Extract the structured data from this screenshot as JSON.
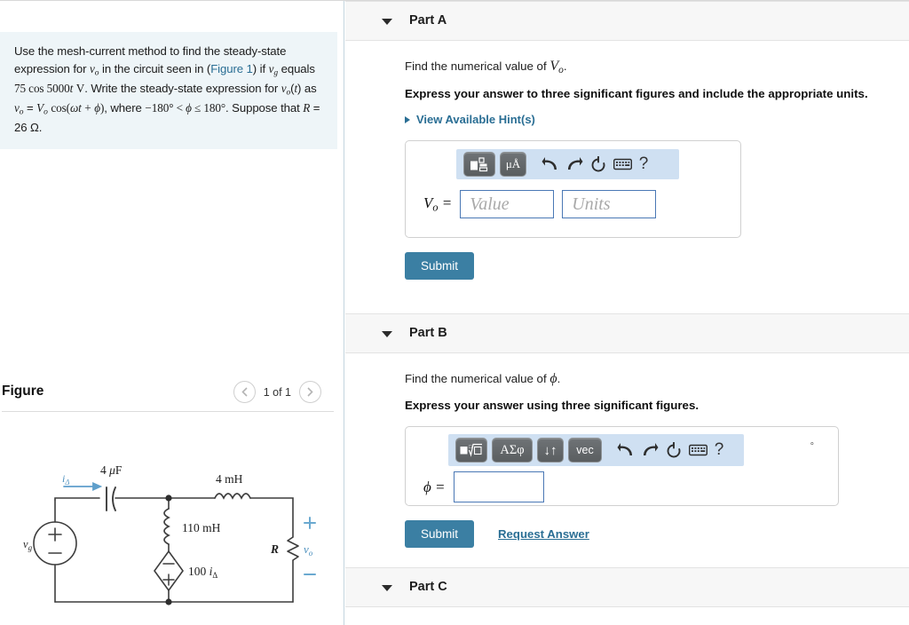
{
  "problem": {
    "paragraph_parts": [
      "Use the mesh-current method to find the steady-state expression for ",
      "v",
      "o",
      " in the circuit seen in (",
      "Figure 1",
      ") if ",
      "v",
      "g",
      " equals ",
      "75 cos 5000t",
      " V. Write the steady-state expression for ",
      "v",
      "o",
      "(",
      "t",
      ") as ",
      "v",
      "o",
      " = ",
      "V",
      "o",
      " cos(",
      "ωt",
      " + ",
      "φ",
      "), where ",
      "−180° < φ ≤ 180°",
      ". Suppose that ",
      "R",
      " = 26 Ω."
    ],
    "figure_link": "Figure 1",
    "resistance": "R = 26 Ω",
    "source": "75 cos 5000t V",
    "phase_range": "−180° < ϕ ≤ 180°"
  },
  "figure": {
    "title": "Figure",
    "counter": "1 of 1",
    "prev_icon": "chevron-left-icon",
    "next_icon": "chevron-right-icon",
    "circuit": {
      "source_label": "vg",
      "current_label": "iΔ",
      "capacitor": "4 μF",
      "series_inductor": "4 mH",
      "shunt_inductor": "110 mH",
      "dependent_source": "100 iΔ",
      "resistor_label": "R",
      "output_label": "vo",
      "plus": "+",
      "minus": "−"
    }
  },
  "parts": [
    {
      "id": "part-a",
      "label": "Part A",
      "caret_icon": "caret-down-icon",
      "question": "Find the numerical value of Vo.",
      "question_prefix": "Find the numerical value of ",
      "question_var": "V",
      "question_sub": "o",
      "instruction": "Express your answer to three significant figures and include the appropriate units.",
      "hint_label": "View Available Hint(s)",
      "hint_icon": "caret-right-icon",
      "answer_label": "Vo =",
      "toolbar": [
        {
          "name": "math-template-button",
          "glyph": "template"
        },
        {
          "name": "units-button",
          "glyph": "μÅ"
        },
        {
          "name": "undo-button",
          "glyph": "undo"
        },
        {
          "name": "redo-button",
          "glyph": "redo"
        },
        {
          "name": "reset-button",
          "glyph": "reset"
        },
        {
          "name": "keyboard-button",
          "glyph": "keyboard"
        },
        {
          "name": "help-button",
          "glyph": "?"
        }
      ],
      "value_placeholder": "Value",
      "units_placeholder": "Units",
      "submit_label": "Submit"
    },
    {
      "id": "part-b",
      "label": "Part B",
      "caret_icon": "caret-down-icon",
      "question": "Find the numerical value of ϕ.",
      "question_prefix": "Find the numerical value of ",
      "question_var": "ϕ",
      "instruction": "Express your answer using three significant figures.",
      "answer_label": "ϕ =",
      "degree_symbol": "°",
      "toolbar": [
        {
          "name": "math-template-button",
          "glyph": "radical"
        },
        {
          "name": "greek-button",
          "glyph": "ΑΣφ"
        },
        {
          "name": "arrows-button",
          "glyph": "↓↑"
        },
        {
          "name": "vector-button",
          "glyph": "vec"
        },
        {
          "name": "undo-button",
          "glyph": "undo"
        },
        {
          "name": "redo-button",
          "glyph": "redo"
        },
        {
          "name": "reset-button",
          "glyph": "reset"
        },
        {
          "name": "keyboard-button",
          "glyph": "keyboard"
        },
        {
          "name": "help-button",
          "glyph": "?"
        }
      ],
      "input_value": "",
      "submit_label": "Submit",
      "request_answer_label": "Request Answer"
    },
    {
      "id": "part-c",
      "label": "Part C",
      "caret_icon": "caret-down-icon"
    }
  ],
  "colors": {
    "accent_link": "#2a6e94",
    "submit_bg": "#3b7fa3",
    "problem_bg": "#eef5f8",
    "band_bg": "#f7f7f7",
    "toolbar_bg": "#cfe0f2",
    "circuit_blue": "#6aa9d0",
    "input_border": "#4a78b5"
  }
}
